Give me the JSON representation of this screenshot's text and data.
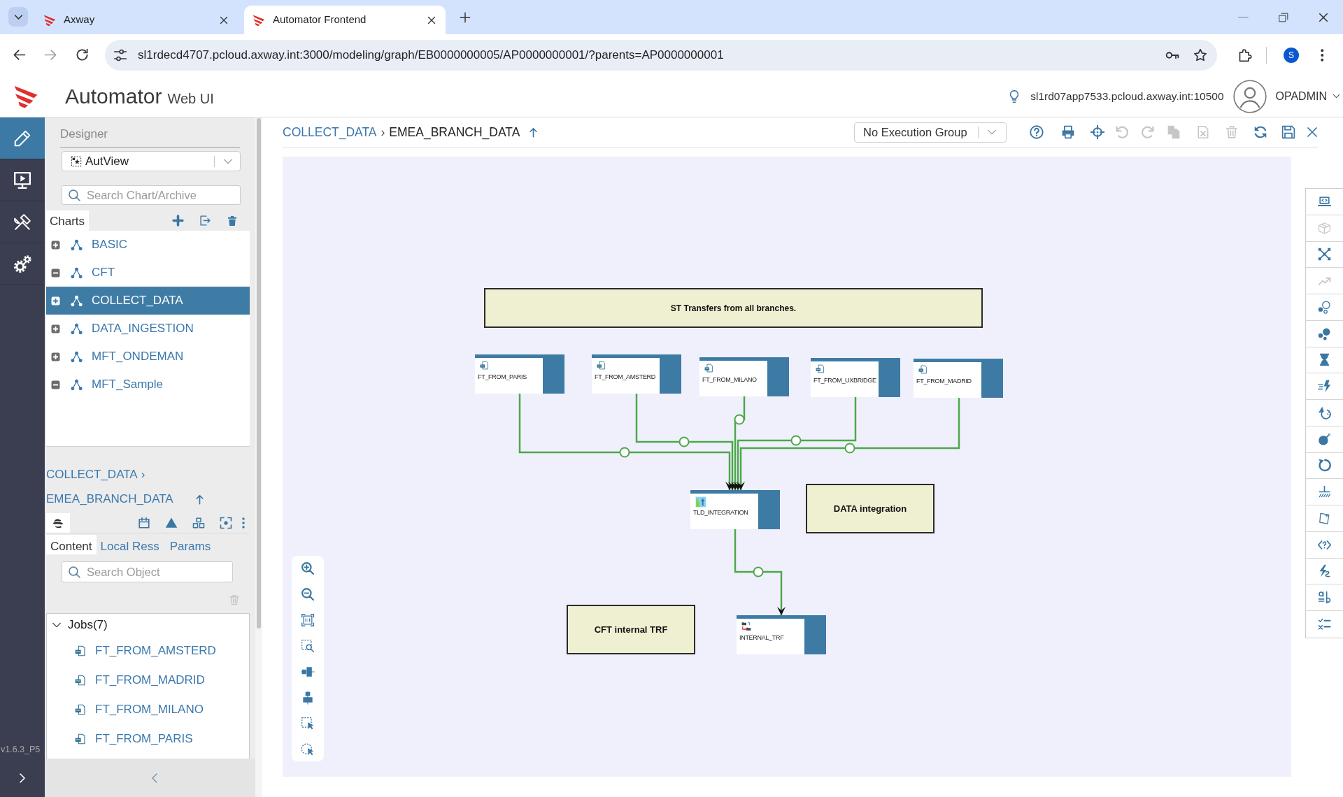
{
  "browser": {
    "tabs": [
      {
        "title": "Axway",
        "selected": false
      },
      {
        "title": "Automator Frontend",
        "selected": true
      }
    ],
    "address": "sl1rdecd4707.pcloud.axway.int:3000/modeling/graph/EB0000000005/AP0000000001/?parents=AP0000000001",
    "profile": "S"
  },
  "header": {
    "title": "Automator",
    "subtitle": "Web UI",
    "server": "sl1rd07app7533.pcloud.axway.int:10500",
    "user": "OPADMIN"
  },
  "rail": {
    "items": [
      {
        "kind": "designer",
        "selected": true
      },
      {
        "kind": "monitor",
        "selected": false
      },
      {
        "kind": "tools",
        "selected": false
      },
      {
        "kind": "settings",
        "selected": false
      }
    ],
    "version": "v1.6.3_P5"
  },
  "panel": {
    "section_title": "Designer",
    "view_select": {
      "value": "AutView"
    },
    "chart_search": {
      "placeholder": "Search Chart/Archive"
    },
    "charts_tab": "Charts",
    "charts": [
      {
        "label": "BASIC",
        "expanded": false,
        "selected": false
      },
      {
        "label": "CFT",
        "expanded": true,
        "selected": false
      },
      {
        "label": "COLLECT_DATA",
        "expanded": false,
        "selected": true
      },
      {
        "label": "DATA_INGESTION",
        "expanded": false,
        "selected": false
      },
      {
        "label": "MFT_ONDEMAN",
        "expanded": false,
        "selected": false
      },
      {
        "label": "MFT_Sample",
        "expanded": true,
        "selected": false
      }
    ],
    "breadcrumb": {
      "parent": "COLLECT_DATA",
      "separator": "›",
      "current": "EMEA_BRANCH_DATA"
    },
    "object_tabs": [
      {
        "label": "Content",
        "selected": true
      },
      {
        "label": "Local Ress",
        "selected": false
      },
      {
        "label": "Params",
        "selected": false
      }
    ],
    "object_search": {
      "placeholder": "Search Object"
    },
    "jobs": {
      "title": "Jobs(7)",
      "expanded": true,
      "items": [
        "FT_FROM_AMSTERD",
        "FT_FROM_MADRID",
        "FT_FROM_MILANO",
        "FT_FROM_PARIS"
      ]
    }
  },
  "editor": {
    "breadcrumb": {
      "parent": "COLLECT_DATA",
      "separator": "›",
      "current": "EMEA_BRANCH_DATA"
    },
    "execution_group": {
      "value": "No Execution Group"
    },
    "actions": [
      {
        "kind": "help",
        "disabled": false
      },
      {
        "kind": "print",
        "disabled": false
      },
      {
        "kind": "center",
        "disabled": false
      },
      {
        "kind": "undo",
        "disabled": true
      },
      {
        "kind": "redo",
        "disabled": true
      },
      {
        "kind": "copy",
        "disabled": true
      },
      {
        "kind": "delete-file",
        "disabled": true
      },
      {
        "kind": "trash",
        "disabled": true
      },
      {
        "kind": "refresh",
        "disabled": false
      },
      {
        "kind": "save",
        "disabled": false
      },
      {
        "kind": "close",
        "disabled": false
      }
    ],
    "notes": [
      {
        "text": "ST Transfers from all branches."
      },
      {
        "text": "DATA integration"
      },
      {
        "text": "CFT internal TRF"
      }
    ],
    "nodes": [
      {
        "label": "FT_FROM_PARIS",
        "kind": "file-transfer"
      },
      {
        "label": "FT_FROM_AMSTERD",
        "kind": "file-transfer"
      },
      {
        "label": "FT_FROM_MILANO",
        "kind": "file-transfer"
      },
      {
        "label": "FT_FROM_UXBRIDGE",
        "kind": "file-transfer"
      },
      {
        "label": "FT_FROM_MADRID",
        "kind": "file-transfer"
      },
      {
        "label": "TLD_INTEGRATION",
        "kind": "integration"
      },
      {
        "label": "INTERNAL_TRF",
        "kind": "internal-transfer"
      }
    ],
    "palette": [
      {
        "kind": "script",
        "disabled": false
      },
      {
        "kind": "package",
        "disabled": true
      },
      {
        "kind": "network",
        "disabled": false
      },
      {
        "kind": "trend",
        "disabled": true
      },
      {
        "kind": "bubbles-outline",
        "disabled": false
      },
      {
        "kind": "bubbles",
        "disabled": false
      },
      {
        "kind": "wait",
        "disabled": false
      },
      {
        "kind": "trigger",
        "disabled": false
      },
      {
        "kind": "recovery",
        "disabled": false
      },
      {
        "kind": "bomb",
        "disabled": false
      },
      {
        "kind": "loop",
        "disabled": false
      },
      {
        "kind": "ground",
        "disabled": false
      },
      {
        "kind": "note",
        "disabled": false
      },
      {
        "kind": "query",
        "disabled": false
      },
      {
        "kind": "event",
        "disabled": false
      },
      {
        "kind": "assign",
        "disabled": false
      },
      {
        "kind": "checklist",
        "disabled": false
      }
    ]
  }
}
